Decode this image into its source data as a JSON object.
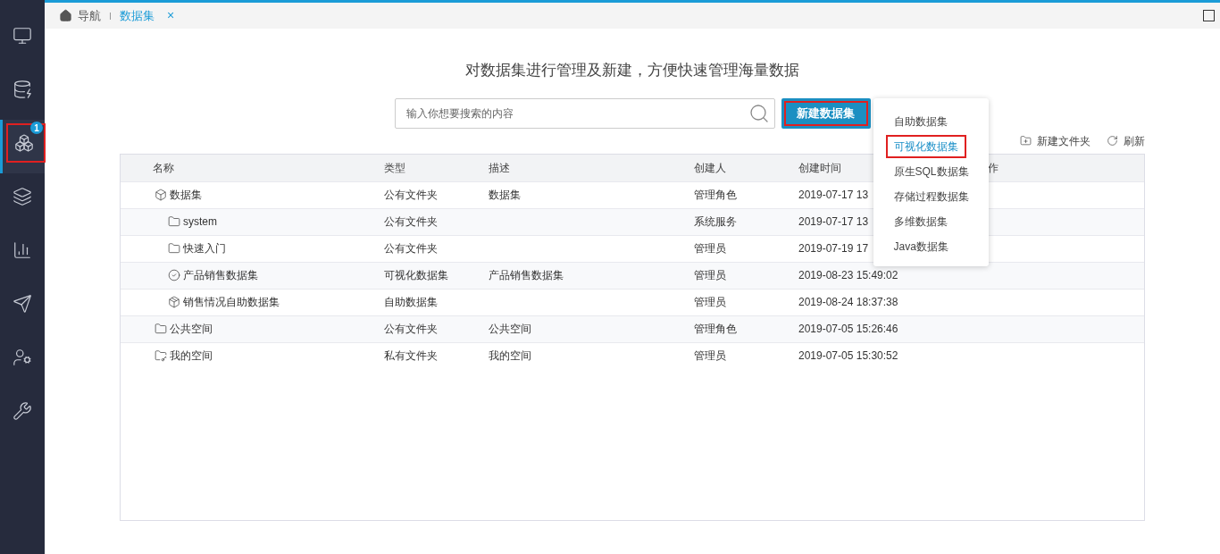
{
  "sidebar": {
    "items": [
      {
        "kind": "monitor",
        "selected": false,
        "highlighted": false
      },
      {
        "kind": "database",
        "selected": false,
        "highlighted": false
      },
      {
        "kind": "boxes",
        "selected": true,
        "highlighted": true,
        "badge": "1"
      },
      {
        "kind": "layers",
        "selected": false,
        "highlighted": false
      },
      {
        "kind": "chart",
        "selected": false,
        "highlighted": false
      },
      {
        "kind": "send",
        "selected": false,
        "highlighted": false
      },
      {
        "kind": "user-gear",
        "selected": false,
        "highlighted": false
      },
      {
        "kind": "tools",
        "selected": false,
        "highlighted": false
      }
    ]
  },
  "tabs": [
    {
      "kind": "home",
      "label": "导航",
      "selected": false
    },
    {
      "kind": "page",
      "label": "数据集",
      "selected": true,
      "close": "×"
    }
  ],
  "title": "对数据集进行管理及新建，方便快速管理海量数据",
  "search": {
    "placeholder": "输入你想要搜索的内容"
  },
  "new_button": {
    "label": "新建数据集",
    "highlighted": true
  },
  "menu": [
    {
      "label": "自助数据集",
      "selected": false
    },
    {
      "label": "可视化数据集",
      "selected": true
    },
    {
      "label": "原生SQL数据集",
      "selected": false
    },
    {
      "label": "存储过程数据集",
      "selected": false
    },
    {
      "label": "多维数据集",
      "selected": false
    },
    {
      "label": "Java数据集",
      "selected": false
    }
  ],
  "toolbar": {
    "new_folder": "新建文件夹",
    "refresh": "刷新"
  },
  "table": {
    "columns": [
      "名称",
      "类型",
      "描述",
      "创建人",
      "创建时间",
      "作"
    ],
    "rows": [
      {
        "kind": "dataset",
        "name": "数据集",
        "type": "公有文件夹",
        "desc": "数据集",
        "creator": "管理角色",
        "time": "2019-07-17 13",
        "children": [
          {
            "kind": "folder",
            "name": "system",
            "type": "公有文件夹",
            "creator": "系统服务",
            "time": "2019-07-17 13"
          },
          {
            "kind": "folder",
            "name": "快速入门",
            "type": "公有文件夹",
            "creator": "管理员",
            "time": "2019-07-19 17"
          },
          {
            "kind": "visual",
            "name": "产品销售数据集",
            "type": "可视化数据集",
            "desc": "产品销售数据集",
            "creator": "管理员",
            "time": "2019-08-23 15:49:02"
          },
          {
            "kind": "selfservice",
            "name": "销售情况自助数据集",
            "type": "自助数据集",
            "creator": "管理员",
            "time": "2019-08-24 18:37:38"
          }
        ]
      },
      {
        "kind": "folder",
        "name": "公共空间",
        "type": "公有文件夹",
        "desc": "公共空间",
        "creator": "管理角色",
        "time": "2019-07-05 15:26:46"
      },
      {
        "kind": "userfolder",
        "name": "我的空间",
        "type": "私有文件夹",
        "desc": "我的空间",
        "creator": "管理员",
        "time": "2019-07-05 15:30:52"
      }
    ]
  }
}
